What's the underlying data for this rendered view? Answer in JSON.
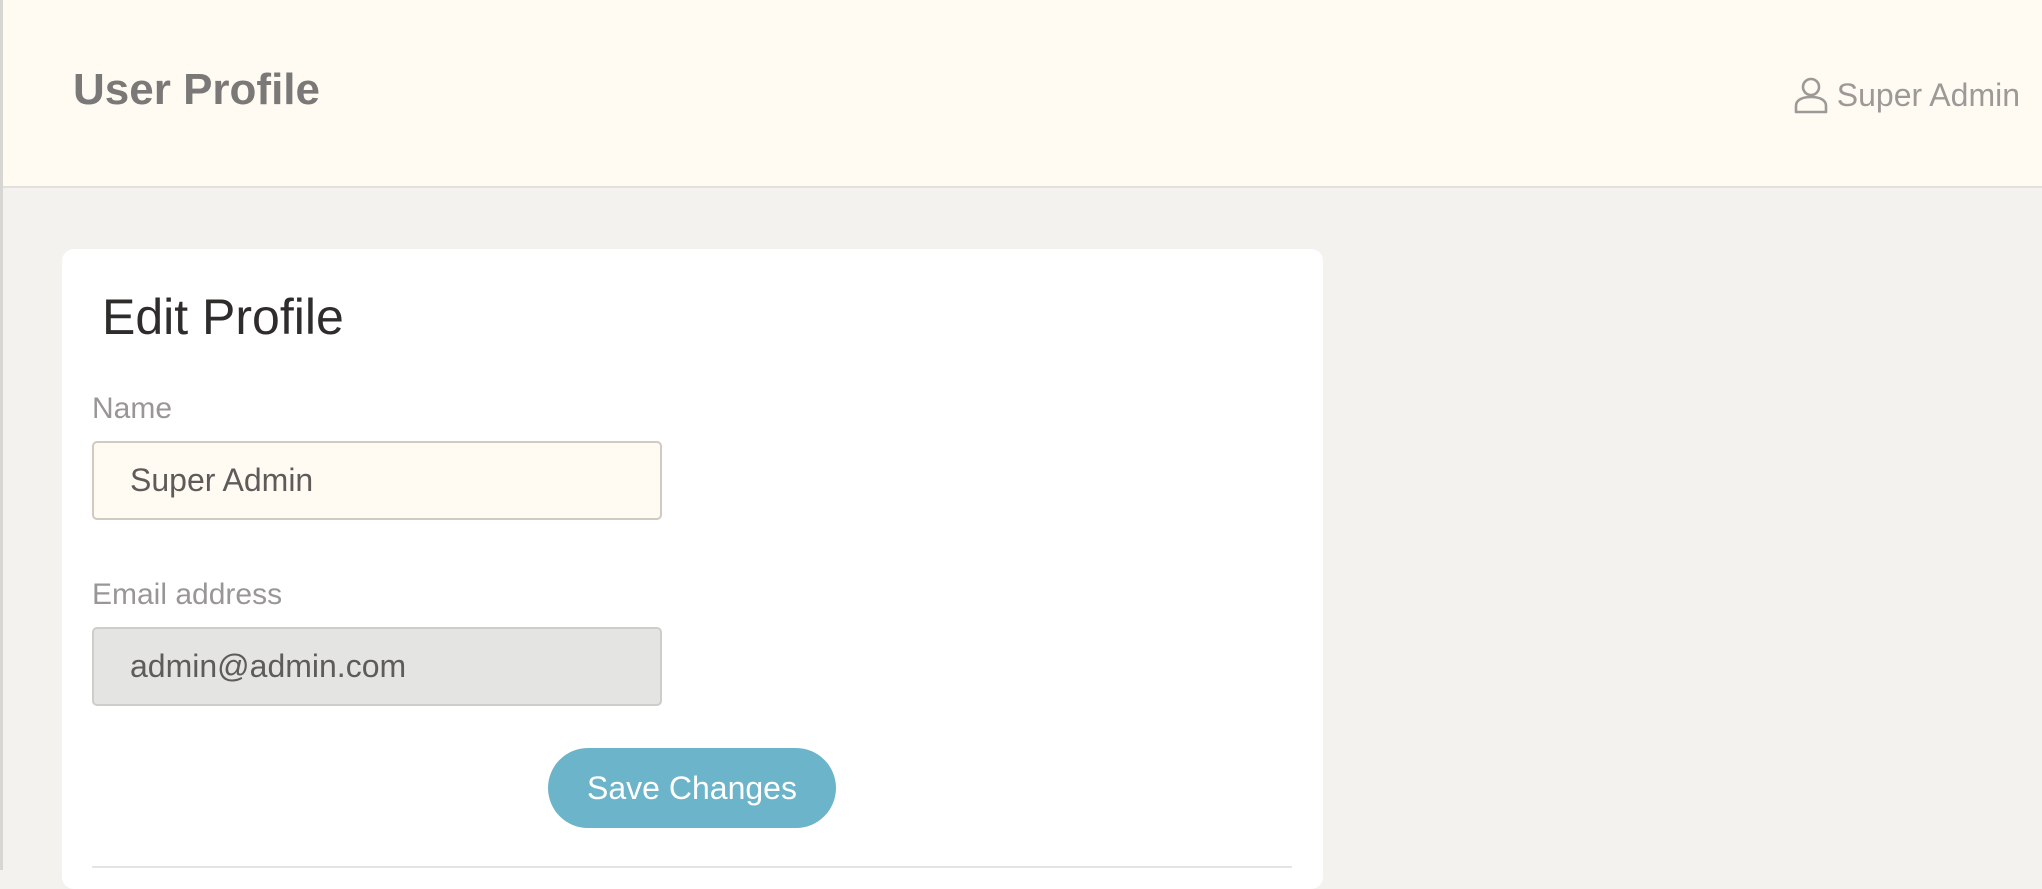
{
  "header": {
    "title": "User Profile",
    "user_name": "Super Admin"
  },
  "profile_form": {
    "title": "Edit Profile",
    "name_label": "Name",
    "name_value": "Super Admin",
    "email_label": "Email address",
    "email_value": "admin@admin.com",
    "email_disabled": true,
    "save_label": "Save Changes"
  },
  "icons": {
    "user_menu": "user-icon"
  },
  "colors": {
    "header_bg": "#fffbf3",
    "page_bg": "#f3f2ef",
    "accent_button": "#6cb4c9",
    "disabled_input_bg": "#e4e4e3"
  }
}
